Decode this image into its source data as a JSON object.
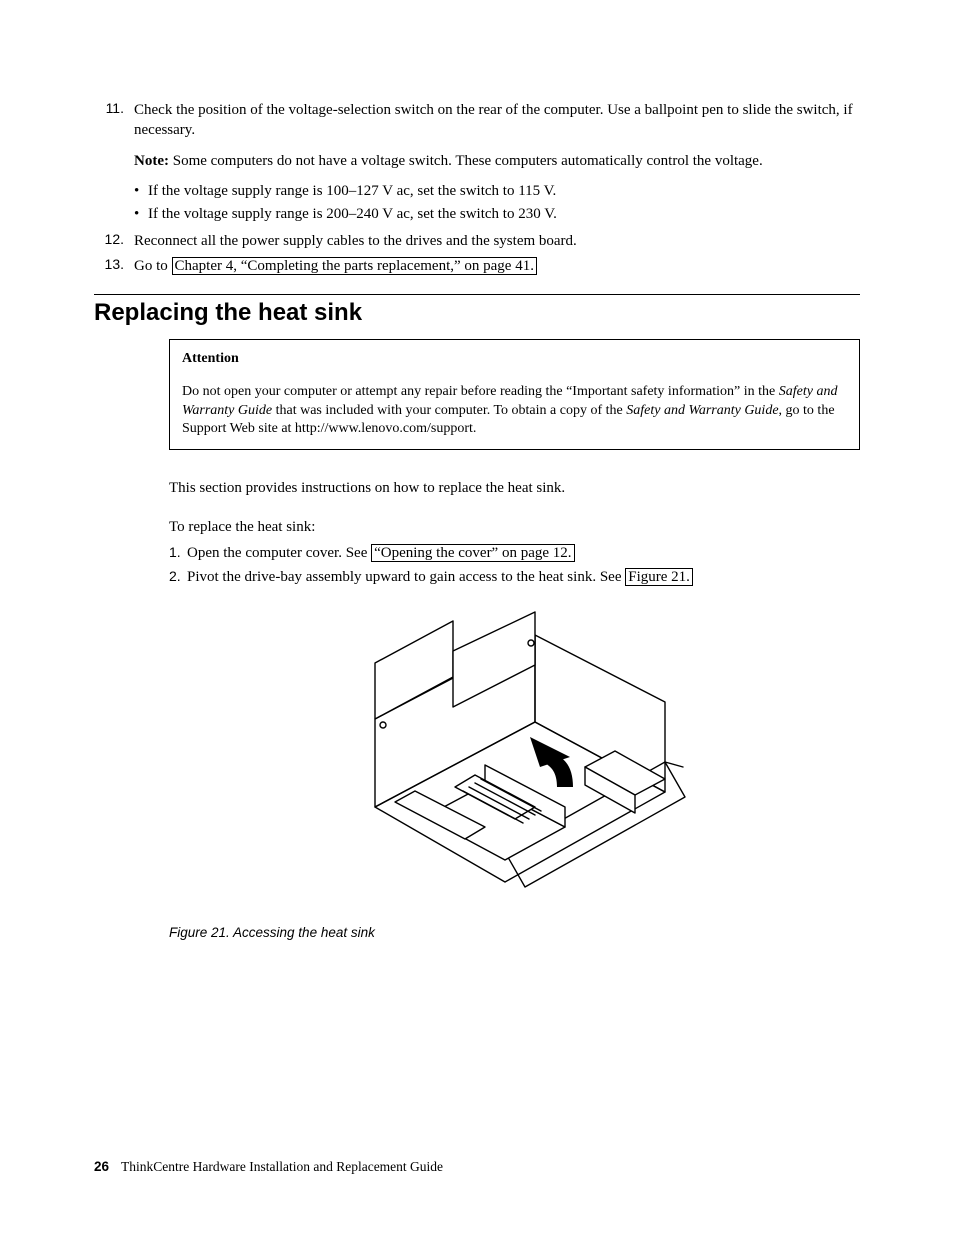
{
  "continued_steps": {
    "item11": {
      "num": "11.",
      "text": "Check the position of the voltage-selection switch on the rear of the computer. Use a ballpoint pen to slide the switch, if necessary.",
      "note_label": "Note:",
      "note_text": " Some computers do not have a voltage switch. These computers automatically control the voltage.",
      "bullet_a": "If the voltage supply range is 100–127 V ac, set the switch to 115 V.",
      "bullet_b": "If the voltage supply range is 200–240 V ac, set the switch to 230 V."
    },
    "item12": {
      "num": "12.",
      "text": "Reconnect all the power supply cables to the drives and the system board."
    },
    "item13": {
      "num": "13.",
      "goto": "Go to ",
      "link": "Chapter 4, “Completing the parts replacement,” on page 41."
    }
  },
  "section_heading": "Replacing the heat sink",
  "attention": {
    "title": "Attention",
    "p1_a": "Do not open your computer or attempt any repair before reading the “Important safety information” in the ",
    "p1_it1": "Safety and Warranty Guide",
    "p1_b": " that was included with your computer. To obtain a copy of the ",
    "p1_it2": "Safety and Warranty Guide",
    "p1_c": ", go to the Support Web site at http://www.lenovo.com/support."
  },
  "intro": "This section provides instructions on how to replace the heat sink.",
  "to_replace": "To replace the heat sink:",
  "steps": {
    "s1": {
      "num": "1.",
      "a": "Open the computer cover. See ",
      "link": "“Opening the cover” on page 12."
    },
    "s2": {
      "num": "2.",
      "a": "Pivot the drive-bay assembly upward to gain access to the heat sink. See ",
      "link": "Figure 21.",
      "after": ""
    }
  },
  "figure_caption": "Figure 21. Accessing the heat sink",
  "footer": {
    "page": "26",
    "title": "ThinkCentre Hardware Installation and Replacement Guide"
  }
}
